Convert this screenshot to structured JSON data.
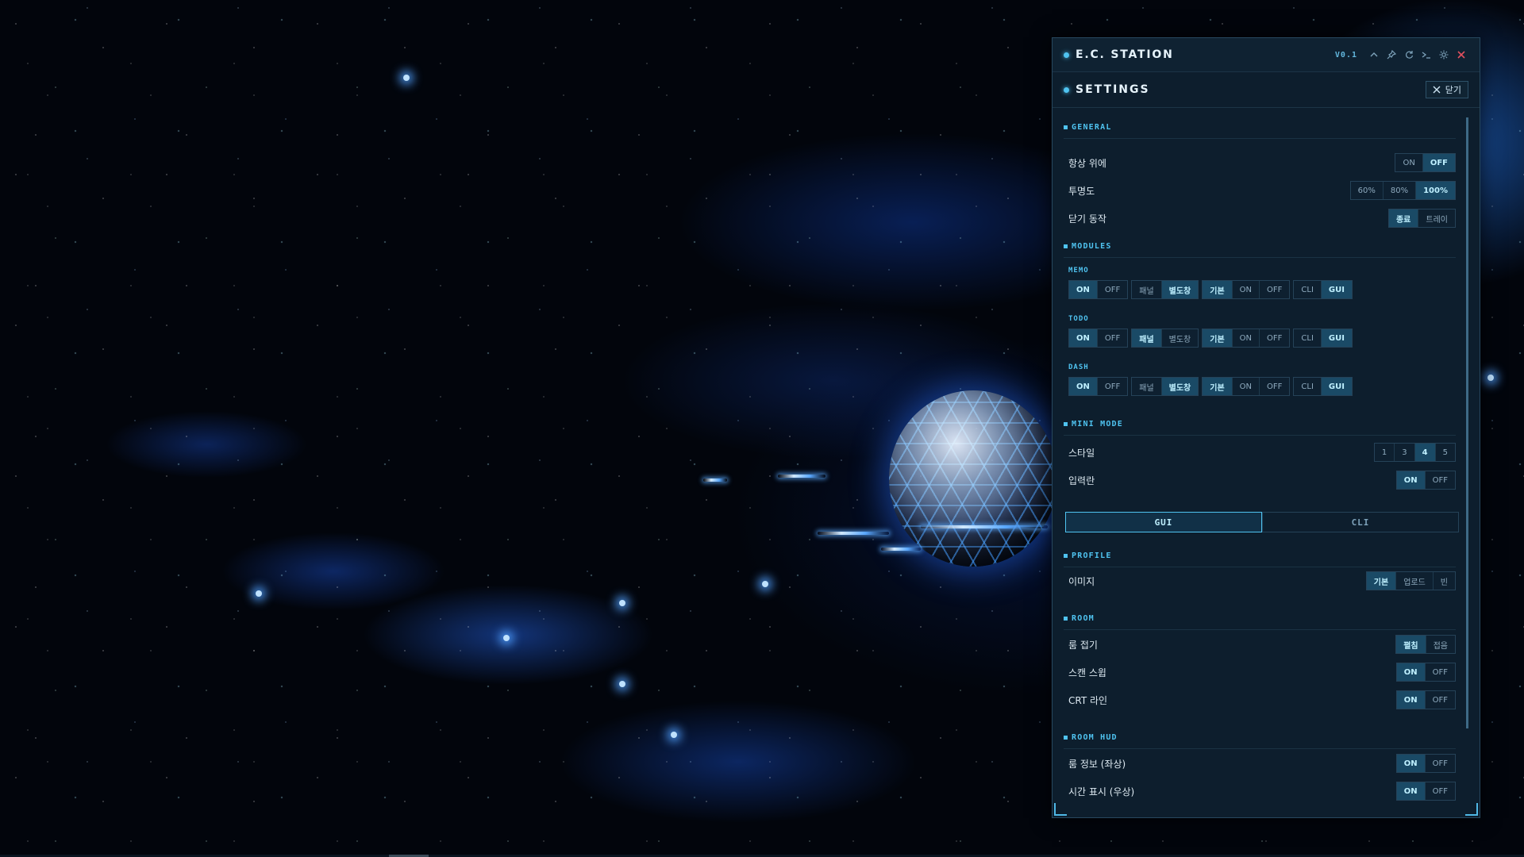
{
  "window": {
    "title": "E.C. STATION",
    "version": "V0.1",
    "titlebar_icons": [
      "chevron-up-icon",
      "pin-icon",
      "refresh-icon",
      "terminal-icon",
      "settings-icon",
      "close-icon"
    ]
  },
  "settings": {
    "title": "SETTINGS",
    "close_label": "닫기"
  },
  "general": {
    "header": "GENERAL",
    "always_on_top": {
      "label": "항상 위에",
      "options": [
        "ON",
        "OFF"
      ],
      "selected": "OFF"
    },
    "opacity": {
      "label": "투명도",
      "options": [
        "60%",
        "80%",
        "100%"
      ],
      "selected": "100%"
    },
    "close_action": {
      "label": "닫기 동작",
      "options": [
        "종료",
        "트레이"
      ],
      "selected": "종료"
    }
  },
  "modules": {
    "header": "MODULES",
    "items": [
      {
        "name": "MEMO",
        "power": [
          "ON",
          "OFF"
        ],
        "power_sel": "ON",
        "view": [
          "패널",
          "별도창"
        ],
        "view_sel": "별도창",
        "mode": [
          "기본",
          "ON",
          "OFF"
        ],
        "mode_sel": "기본",
        "ui": [
          "CLI",
          "GUI"
        ],
        "ui_sel": "GUI"
      },
      {
        "name": "TODO",
        "power": [
          "ON",
          "OFF"
        ],
        "power_sel": "ON",
        "view": [
          "패널",
          "별도창"
        ],
        "view_sel": "패널",
        "mode": [
          "기본",
          "ON",
          "OFF"
        ],
        "mode_sel": "기본",
        "ui": [
          "CLI",
          "GUI"
        ],
        "ui_sel": "GUI"
      },
      {
        "name": "DASH",
        "power": [
          "ON",
          "OFF"
        ],
        "power_sel": "ON",
        "view": [
          "패널",
          "별도창"
        ],
        "view_sel": "별도창",
        "mode": [
          "기본",
          "ON",
          "OFF"
        ],
        "mode_sel": "기본",
        "ui": [
          "CLI",
          "GUI"
        ],
        "ui_sel": "GUI"
      }
    ]
  },
  "mini_mode": {
    "header": "MINI MODE",
    "style": {
      "label": "스타일",
      "options": [
        "1",
        "3",
        "4",
        "5"
      ],
      "selected": "4"
    },
    "input": {
      "label": "입력란",
      "options": [
        "ON",
        "OFF"
      ],
      "selected": "ON"
    }
  },
  "ui_tabs": {
    "options": [
      "GUI",
      "CLI"
    ],
    "selected": "GUI"
  },
  "profile": {
    "header": "PROFILE",
    "image": {
      "label": "이미지",
      "options": [
        "기본",
        "업로드",
        "빈"
      ],
      "selected": "기본"
    }
  },
  "room": {
    "header": "ROOM",
    "fold": {
      "label": "룸 접기",
      "options": [
        "펼침",
        "접음"
      ],
      "selected": "펼침"
    },
    "scan_sweep": {
      "label": "스캔 스윕",
      "options": [
        "ON",
        "OFF"
      ],
      "selected": "ON"
    },
    "crt_line": {
      "label": "CRT 라인",
      "options": [
        "ON",
        "OFF"
      ],
      "selected": "ON"
    }
  },
  "room_hud": {
    "header": "ROOM HUD",
    "room_info": {
      "label": "룸 정보 (좌상)",
      "options": [
        "ON",
        "OFF"
      ],
      "selected": "ON"
    },
    "time_display": {
      "label": "시간 표시 (우상)",
      "options": [
        "ON",
        "OFF"
      ],
      "selected": "ON"
    }
  },
  "colors": {
    "accent": "#4fc3f0",
    "panel_bg": "#0d1e2d",
    "close_red": "#e0505e"
  }
}
